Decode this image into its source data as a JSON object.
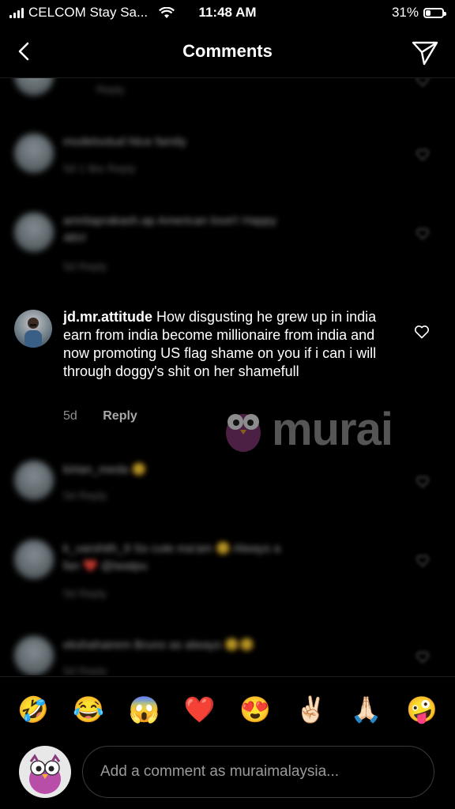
{
  "status_bar": {
    "carrier": "CELCOM Stay Sa...",
    "time": "11:48 AM",
    "battery": "31%",
    "battery_level": 0.31
  },
  "header": {
    "title": "Comments"
  },
  "blurred_comments": [
    {
      "text": "Reply"
    },
    {
      "text": "modelootud Nice family",
      "meta": "5d  1 like  Reply"
    },
    {
      "text": "amritaprakash.ap American love!! Happy",
      "text2": "4th!!",
      "meta": "5d  Reply"
    },
    {
      "text": "kirtan_meda 😊",
      "meta": "5d  Reply"
    },
    {
      "text": "k_varshith_9 So cute ma'am 😊 Always a",
      "text2": "fan ❤️ @iwatpu",
      "meta": "5d  Reply"
    },
    {
      "text": "ekshahairem Bruno as always 😊😊",
      "meta": "5d  Reply"
    }
  ],
  "focus_comment": {
    "username": "jd.mr.attitude",
    "text": "How disgusting he grew up in india earn from india become millionaire from india and now promoting US flag shame on you if i can i will through doggy's shit on her shamefull",
    "age": "5d",
    "reply_label": "Reply"
  },
  "watermark": {
    "text": "murai"
  },
  "emoji_bar": [
    "🤣",
    "😂",
    "😱",
    "❤️",
    "😍",
    "✌🏻",
    "🙏🏻",
    "🤪"
  ],
  "composer": {
    "placeholder": "Add a comment as muraimalaysia..."
  },
  "colors": {
    "background": "#000000",
    "muted": "#8e8e8e",
    "text": "#ffffff"
  }
}
